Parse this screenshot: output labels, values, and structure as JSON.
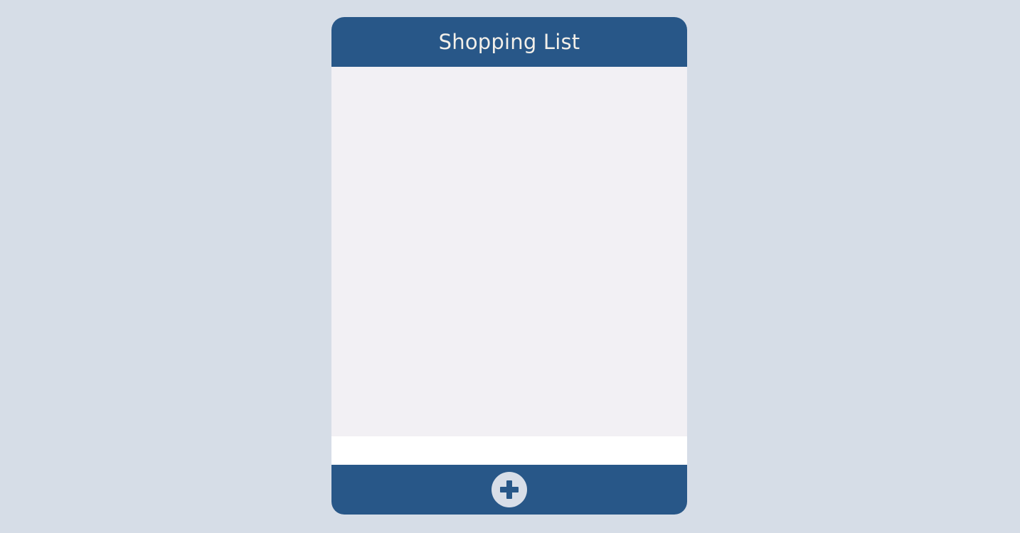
{
  "app": {
    "title": "Shopping List"
  },
  "input": {
    "value": "",
    "placeholder": ""
  },
  "footer": {
    "add_icon": "plus-icon"
  },
  "colors": {
    "page_background": "#d6dde7",
    "bar": "#285788",
    "list_background": "#f2f0f4",
    "input_background": "#ffffff",
    "title_text": "#f2efe9",
    "add_button_background": "#d8dee8"
  }
}
